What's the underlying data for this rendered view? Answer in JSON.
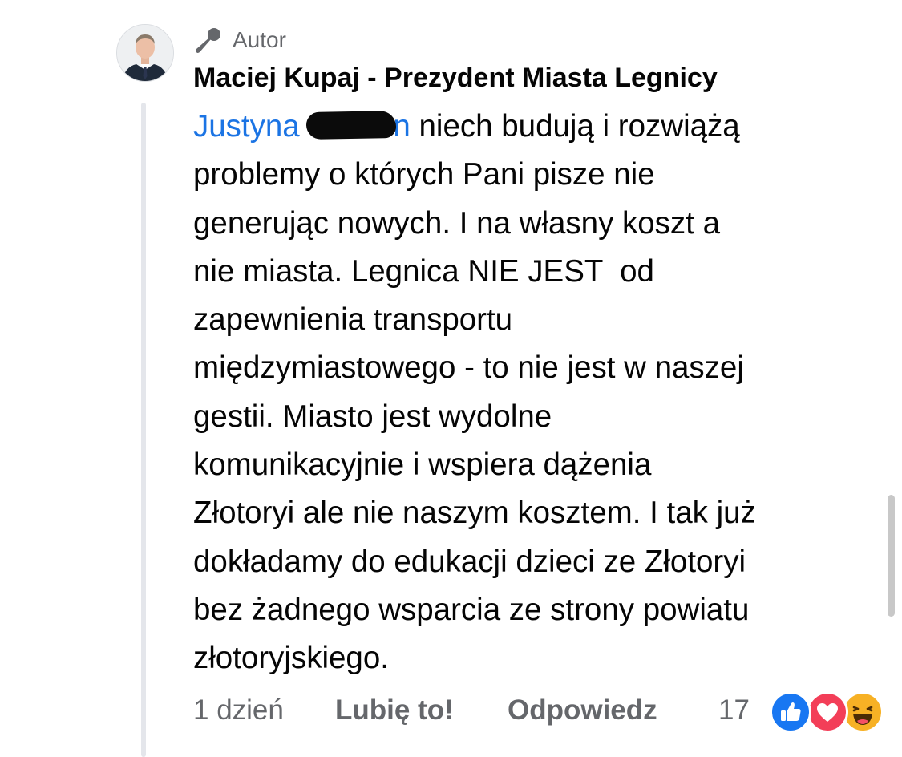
{
  "comment": {
    "badge_label": "Autor",
    "author_name": "Maciej Kupaj - Prezydent Miasta Legnicy",
    "mention_name": "Justyna",
    "mention_suffix": "n",
    "lines": [
      "niech budują i rozwiążą",
      "problemy o których Pani pisze nie",
      "generując nowych. I na własny koszt a",
      "nie miasta. Legnica NIE JEST  od",
      "zapewnienia transportu",
      "międzymiastowego - to nie jest w naszej",
      "gestii. Miasto jest wydolne",
      "komunikacyjnie i wspiera dążenia",
      "Złotoryi ale nie naszym kosztem. I tak już",
      "dokładamy do edukacji dzieci ze Złotoryi",
      "bez żadnego wsparcia ze strony powiatu",
      "złotoryjskiego."
    ]
  },
  "footer": {
    "time": "1 dzień",
    "like_label": "Lubię to!",
    "reply_label": "Odpowiedz",
    "reaction_count": "17",
    "reactions": [
      "like-icon",
      "love-icon",
      "haha-icon"
    ]
  },
  "colors": {
    "mention": "#1b74e4",
    "secondary_text": "#65676b",
    "like_blue": "#1877f2",
    "love_red": "#f33e58",
    "haha_yellow": "#f7b125"
  }
}
